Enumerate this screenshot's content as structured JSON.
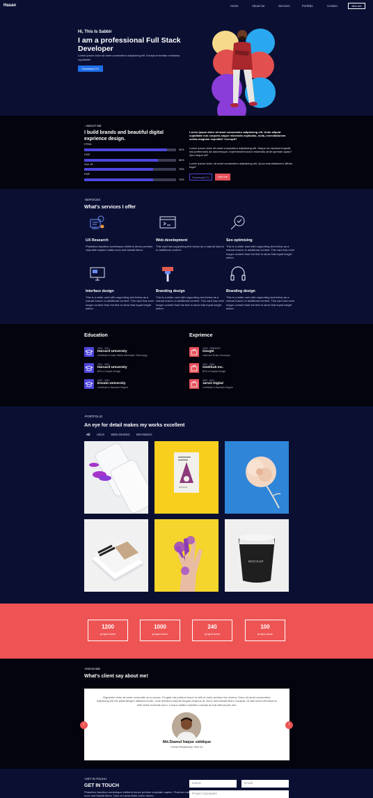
{
  "nav": {
    "brand": "Hasan",
    "links": [
      "Home",
      "About me",
      "Services",
      "Portfolio",
      "Contact"
    ],
    "hire": "Hire me"
  },
  "hero": {
    "greeting": "Hi, This Is Sabbir",
    "title": "I am a professional Full Stack Developer",
    "desc": "Lorem ipsum dolor sit amet consectetur adipisicing elit. Excepturi beatae molestias cupiditate!",
    "cta": "Download CV"
  },
  "about": {
    "kicker": "- ABOUT ME",
    "heading": "I build brands and beautiful digital exprience design.",
    "skills": [
      {
        "label": "HTML",
        "value": 90,
        "pct": "90%"
      },
      {
        "label": "CSS",
        "value": 80,
        "pct": "80%"
      },
      {
        "label": "Vue JS",
        "value": 75,
        "pct": "75%"
      },
      {
        "label": "PHP",
        "value": 75,
        "pct": "75%"
      }
    ],
    "para1": "Lorem ipsum dolor sit amet consectetur adipisicing elit. Unde aliquid cupiditate non corporis eaque reiciendis explicabo, nulla, exercitationem soluta magnam expedita? Corrupti?",
    "para2": "Lorem ipsum dolor sit amet consectetur adipisicing elit. Saepe ea nesciunt impedit nisi perferendis ab doloremque, reprehenderit dolor reiciendis amet aperiam quasi? Quo neque sit?",
    "para3": "Lorem ipsum dolor, sit amet consectetur adipisicing elit. Quos exercitationem officiis fuga?",
    "download": "Download CV",
    "hire": "Hire me"
  },
  "services": {
    "kicker": "-SERVICES",
    "heading": "What's services I offer",
    "items": [
      {
        "title": "UX Research",
        "icon": "ux-research-icon",
        "desc": "Phasellus faucibus scelerisque eleifend donec pretium vulputate sapien mattis nunc sed blandit libero."
      },
      {
        "title": "Web development",
        "icon": "code-window-icon",
        "desc": "This card has supporting text below as a natural lead-in to additional content."
      },
      {
        "title": "Seo optimizing",
        "icon": "seo-magnifier-icon",
        "desc": "This is a wider card with supporting text below as a natural lead-in to additional content. This card has even longer content than the first to show that equal height action."
      },
      {
        "title": "Interface design",
        "icon": "monitor-icon",
        "desc": "This is a wider card with supporting text below as a natural lead-in to additional content. This card has even longer content than the first to show that equal height action."
      },
      {
        "title": "Branding design",
        "icon": "brush-icon",
        "desc": "This is a wider card with supporting text below as a natural lead-in to additional content. This card has even longer content than the first to show that equal height action."
      },
      {
        "title": "Branding design",
        "icon": "headphones-icon",
        "desc": "This is a wider card with supporting text below as a natural lead-in to additional content. This card has even longer content than the first to show that equal height action."
      }
    ]
  },
  "education": {
    "title": "Education",
    "items": [
      {
        "date": "2014 - 2017",
        "org": "Harvard University",
        "sub": "Certificate in basic Media Information Technology"
      },
      {
        "date": "2011 - 2014",
        "org": "Harvard University",
        "sub": "BFA in Graphic Design"
      },
      {
        "date": "2007 - 2011",
        "org": "Envato University",
        "sub": "Certificate in Bachelor Degree"
      }
    ]
  },
  "experience": {
    "title": "Exprience",
    "items": [
      {
        "date": "2018 - PRESENT",
        "org": "Google",
        "sub": "Lead and Senior Developer"
      },
      {
        "date": "2011 - 2014",
        "org": "Geekhub Inc.",
        "sub": "BFA in Graphic Design"
      },
      {
        "date": "2007 - 2011",
        "org": "Jarvis Digital",
        "sub": "Certificate in Bachelor Degree"
      }
    ]
  },
  "portfolio": {
    "kicker": "-PORTFOLIO",
    "heading": "An eye for detail makes my works excellent",
    "filters": [
      "All",
      "UI/UX",
      "WEB DESING",
      "BRANDING"
    ],
    "tiles": [
      "phone-mockup-image",
      "book-cover-image",
      "paper-flower-image",
      "magazine-stack-image",
      "painted-hand-image",
      "coffee-cup-mockup-image"
    ],
    "book_text": "MOCKUP",
    "cup_text": "MOCKUP"
  },
  "stats": [
    {
      "n": "1200",
      "label": "project done"
    },
    {
      "n": "1000",
      "label": "project done"
    },
    {
      "n": "240",
      "label": "project done"
    },
    {
      "n": "100",
      "label": "project done"
    }
  ],
  "testimonials": {
    "kicker": "-testmonials",
    "heading": "What's client say about me!",
    "quote": "Dignissim enim sit amet venenatis urna cursus. Feugiat nisl pretium fusce id velit ut tortor pretium the viverra. Dolor sit amet consectetur adipiscing elit the pellentesque habitant morbi. Cras tincidunt lobortis feugiat vivamus at. Nunc sed blandit libero volutpat. Ut fast lorem elementum nibh tellus molestie nunc. Cursus mattis molestie a iaculis at erat without pib dos.",
    "name": "Md.Siamul haque siddique",
    "role": "Human Relationship, Hiter inc"
  },
  "contact": {
    "kicker": "-GET IN TOUCH",
    "heading": "GET IN TOUCH",
    "desc": "Phasellus faucibus scelerisque eleifend donec pretium vulputate sapien. Pulvinar mattis nunc sed blandit libero. Duis at consectetur lorem donec.",
    "name_ph": "Name",
    "email_ph": "Email",
    "project_ph": "Project Synopsis"
  }
}
